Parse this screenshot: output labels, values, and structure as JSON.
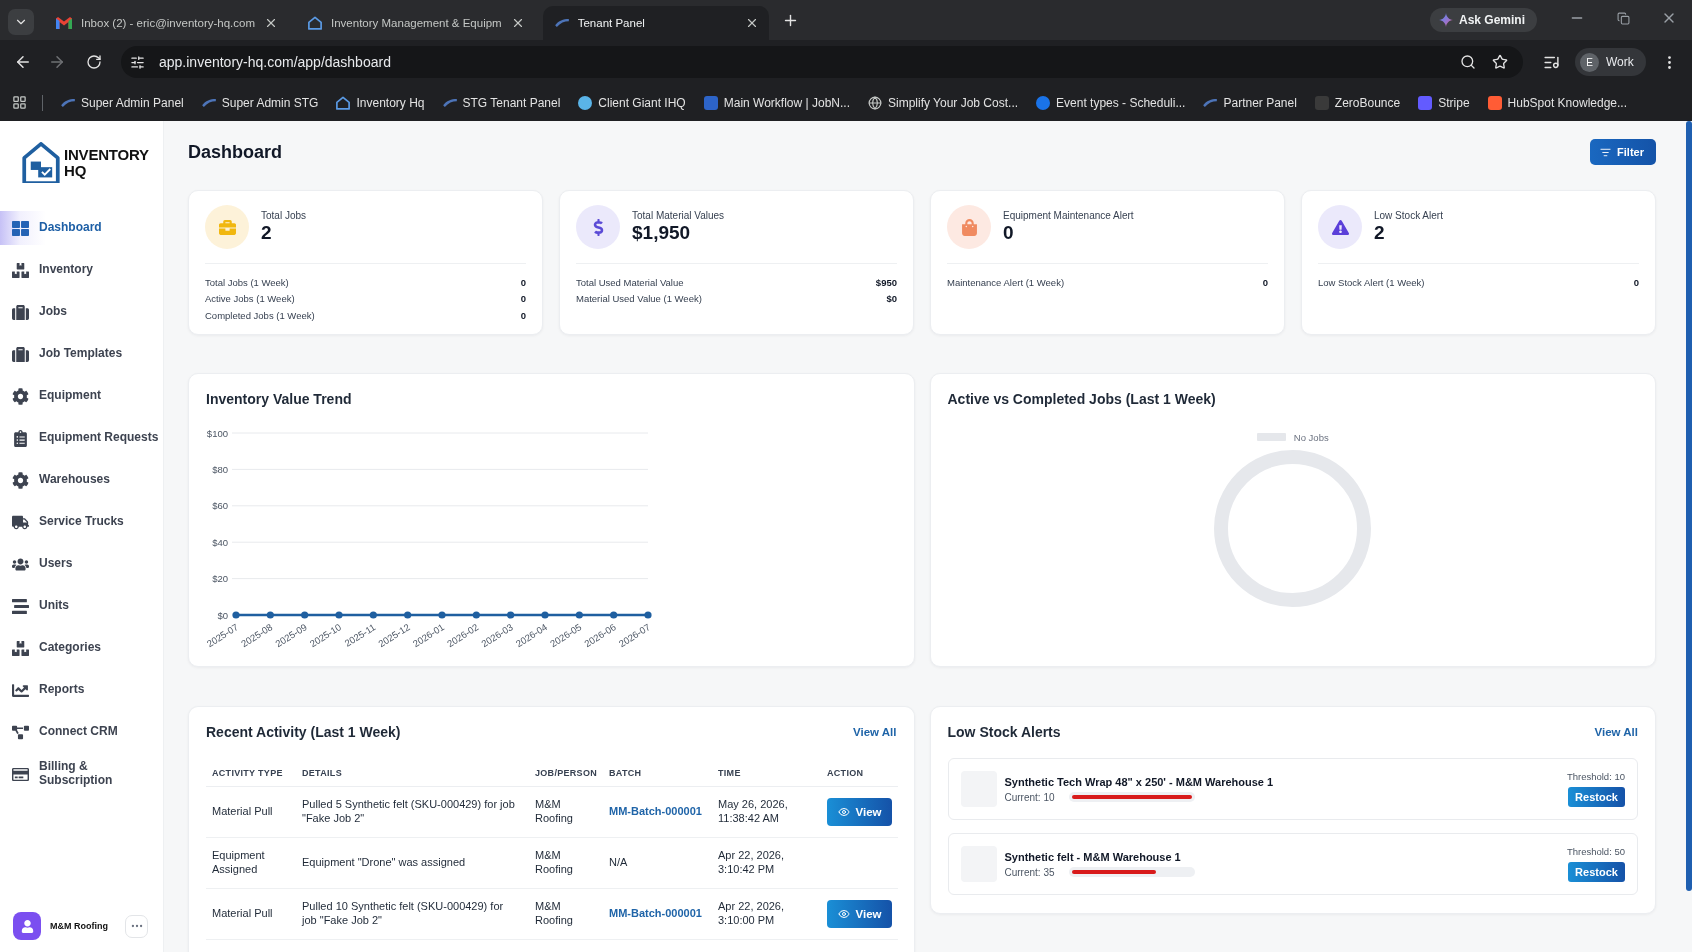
{
  "browser": {
    "tabs": [
      {
        "title": "Inbox (2) - eric@inventory-hq.com",
        "selected": false
      },
      {
        "title": "Inventory Management & Equipm",
        "selected": false
      },
      {
        "title": "Tenant Panel",
        "selected": true
      }
    ],
    "assistant_button": "Ask Gemini",
    "url": "app.inventory-hq.com/app/dashboard",
    "profile": {
      "initial": "E",
      "label": "Work"
    },
    "bookmarks": [
      "Super Admin Panel",
      "Super Admin STG",
      "Inventory Hq",
      "STG Tenant Panel",
      "Client Giant IHQ",
      "Main Workflow | JobN...",
      "Simplify Your Job Cost...",
      "Event types - Scheduli...",
      "Partner Panel",
      "ZeroBounce",
      "Stripe",
      "HubSpot Knowledge..."
    ]
  },
  "sidebar": {
    "logo_text": "INVENTORY HQ",
    "items": [
      {
        "label": "Dashboard",
        "selected": true
      },
      {
        "label": "Inventory",
        "selected": false
      },
      {
        "label": "Jobs",
        "selected": false
      },
      {
        "label": "Job Templates",
        "selected": false
      },
      {
        "label": "Equipment",
        "selected": false
      },
      {
        "label": "Equipment Requests",
        "selected": false
      },
      {
        "label": "Warehouses",
        "selected": false
      },
      {
        "label": "Service Trucks",
        "selected": false
      },
      {
        "label": "Users",
        "selected": false
      },
      {
        "label": "Units",
        "selected": false
      },
      {
        "label": "Categories",
        "selected": false
      },
      {
        "label": "Reports",
        "selected": false
      },
      {
        "label": "Connect CRM",
        "selected": false
      },
      {
        "label": "Billing & Subscription",
        "selected": false
      }
    ],
    "account": "M&M Roofing"
  },
  "header": {
    "title": "Dashboard",
    "filter_button": "Filter"
  },
  "stat_cards": [
    {
      "title": "Total Jobs",
      "value": "2",
      "rows": [
        {
          "label": "Total Jobs (1 Week)",
          "value": "0"
        },
        {
          "label": "Active Jobs (1 Week)",
          "value": "0"
        },
        {
          "label": "Completed Jobs (1 Week)",
          "value": "0"
        }
      ]
    },
    {
      "title": "Total Material Values",
      "value": "$1,950",
      "rows": [
        {
          "label": "Total Used Material Value",
          "value": "$950"
        },
        {
          "label": "Material Used Value (1 Week)",
          "value": "$0"
        }
      ]
    },
    {
      "title": "Equipment Maintenance Alert",
      "value": "0",
      "rows": [
        {
          "label": "Maintenance Alert (1 Week)",
          "value": "0"
        }
      ]
    },
    {
      "title": "Low Stock Alert",
      "value": "2",
      "rows": [
        {
          "label": "Low Stock Alert (1 Week)",
          "value": "0"
        }
      ]
    }
  ],
  "inventory_trend": {
    "title": "Inventory Value Trend",
    "chart_data": {
      "type": "line",
      "categories": [
        "2025-07",
        "2025-08",
        "2025-09",
        "2025-10",
        "2025-11",
        "2025-12",
        "2026-01",
        "2026-02",
        "2026-03",
        "2026-04",
        "2026-05",
        "2026-06",
        "2026-07"
      ],
      "values": [
        0,
        0,
        0,
        0,
        0,
        0,
        0,
        0,
        0,
        0,
        0,
        0,
        0
      ],
      "ylim": [
        0,
        100
      ],
      "yticks": [
        {
          "value": 0,
          "label": "$0"
        },
        {
          "value": 20,
          "label": "$20"
        },
        {
          "value": 40,
          "label": "$40"
        },
        {
          "value": 60,
          "label": "$60"
        },
        {
          "value": 80,
          "label": "$80"
        },
        {
          "value": 100,
          "label": "$100"
        }
      ],
      "grid": true,
      "marker": true
    }
  },
  "jobs_status": {
    "title": "Active vs Completed Jobs (Last 1 Week)",
    "legend": "No Jobs"
  },
  "recent_activity": {
    "title": "Recent Activity (Last 1 Week)",
    "view_all": "View All",
    "columns": [
      "ACTIVITY TYPE",
      "DETAILS",
      "JOB/PERSON",
      "BATCH",
      "TIME",
      "ACTION"
    ],
    "rows": [
      {
        "activity_type": "Material Pull",
        "details": "Pulled 5 Synthetic felt (SKU-000429) for job \"Fake Job 2\"",
        "job_person": "M&M Roofing",
        "batch": {
          "text": "MM-Batch-000001",
          "link": true
        },
        "time": "May 26, 2026, 11:38:42 AM",
        "action": "View"
      },
      {
        "activity_type": "Equipment Assigned",
        "details": "Equipment \"Drone\" was assigned",
        "job_person": "M&M Roofing",
        "batch": {
          "text": "N/A",
          "link": false
        },
        "time": "Apr 22, 2026, 3:10:42 PM"
      },
      {
        "activity_type": "Material Pull",
        "details": "Pulled 10 Synthetic felt (SKU-000429) for job \"Fake Job 2\"",
        "job_person": "M&M Roofing",
        "batch": {
          "text": "MM-Batch-000001",
          "link": true
        },
        "time": "Apr 22, 2026, 3:10:00 PM",
        "action": "View"
      }
    ]
  },
  "low_stock": {
    "title": "Low Stock Alerts",
    "view_all": "View All",
    "items": [
      {
        "name": "Synthetic Tech Wrap 48\" x 250' - M&M Warehouse 1",
        "current": "Current: 10",
        "level": 1,
        "threshold": "Threshold: 10",
        "button": "Restock"
      },
      {
        "name": "Synthetic felt - M&M Warehouse 1",
        "current": "Current: 35",
        "level": 0.7,
        "threshold": "Threshold: 50",
        "button": "Restock"
      }
    ]
  }
}
